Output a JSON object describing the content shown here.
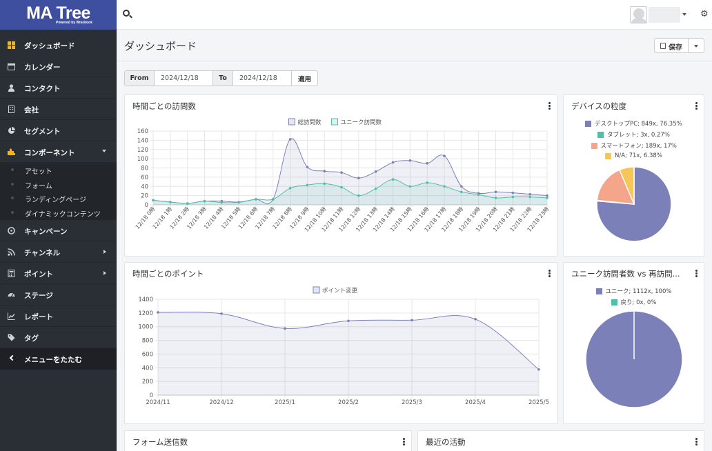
{
  "app": {
    "logo": "MA Tree",
    "logo_sub": "Powered by Wisebook"
  },
  "sidebar": {
    "items": [
      {
        "label": "ダッシュボード",
        "icon": "dashboard-icon"
      },
      {
        "label": "カレンダー",
        "icon": "calendar-icon"
      },
      {
        "label": "コンタクト",
        "icon": "user-icon"
      },
      {
        "label": "会社",
        "icon": "building-icon"
      },
      {
        "label": "セグメント",
        "icon": "pie-chart-icon"
      },
      {
        "label": "コンポーネント",
        "icon": "puzzle-icon"
      },
      {
        "label": "キャンペーン",
        "icon": "clock-icon"
      },
      {
        "label": "チャンネル",
        "icon": "rss-icon"
      },
      {
        "label": "ポイント",
        "icon": "calculator-icon"
      },
      {
        "label": "ステージ",
        "icon": "tachometer-icon"
      },
      {
        "label": "レポート",
        "icon": "line-chart-icon"
      },
      {
        "label": "タグ",
        "icon": "tag-icon"
      }
    ],
    "sub_items": [
      "アセット",
      "フォーム",
      "ランディングページ",
      "ダイナミックコンテンツ"
    ],
    "collapse_label": "メニューをたたむ"
  },
  "colors": {
    "sidebar_bg": "#2a2f36",
    "logo_bg": "#3f4f9f",
    "purple": "#7c80b8",
    "teal": "#4fbfa8",
    "salmon": "#f4a58a",
    "yellow": "#f7c659",
    "accent_orange": "#f4b31e"
  },
  "page": {
    "title": "ダッシュボード",
    "save_label": "保存"
  },
  "filter": {
    "from_label": "From",
    "from_value": "2024/12/18",
    "to_label": "To",
    "to_value": "2024/12/18",
    "apply_label": "適用"
  },
  "panels": {
    "visits_title": "時間ごとの訪問数",
    "device_title": "デバイスの粒度",
    "points_title": "時間ごとのポイント",
    "unique_title": "ユニーク訪問者数 vs 再訪問...",
    "forms_title": "フォーム送信数",
    "activity_title": "最近の活動"
  },
  "chart_data": [
    {
      "type": "area",
      "id": "visits",
      "x": [
        "12/18 0時",
        "12/18 1時",
        "12/18 2時",
        "12/18 3時",
        "12/18 4時",
        "12/18 5時",
        "12/18 6時",
        "12/18 7時",
        "12/18 8時",
        "12/18 9時",
        "12/18 10時",
        "12/18 11時",
        "12/18 12時",
        "12/18 13時",
        "12/18 14時",
        "12/18 15時",
        "12/18 16時",
        "12/18 17時",
        "12/18 18時",
        "12/18 19時",
        "12/18 20時",
        "12/18 21時",
        "12/18 22時",
        "12/18 23時"
      ],
      "series": [
        {
          "name": "総訪問数",
          "color": "#7c80b8",
          "values": [
            10,
            6,
            3,
            8,
            8,
            6,
            12,
            12,
            142,
            82,
            73,
            70,
            58,
            72,
            92,
            96,
            90,
            106,
            40,
            25,
            28,
            26,
            23,
            20
          ]
        },
        {
          "name": "ユニーク訪問数",
          "color": "#4fbfa8",
          "values": [
            10,
            6,
            3,
            8,
            5,
            5,
            12,
            12,
            36,
            43,
            46,
            38,
            20,
            35,
            55,
            40,
            48,
            40,
            28,
            22,
            15,
            17,
            17,
            15
          ]
        }
      ],
      "ylim": [
        0,
        160
      ],
      "yticks": [
        0,
        20,
        40,
        60,
        80,
        100,
        120,
        140,
        160
      ],
      "grid": true,
      "legend": "top"
    },
    {
      "type": "pie",
      "id": "devices",
      "labels": [
        "デスクトップPC; 849x, 76.35%",
        "タブレット; 3x, 0.27%",
        "スマートフォン; 189x, 17%",
        "N/A; 71x, 6.38%"
      ],
      "values": [
        76.35,
        0.27,
        17,
        6.38
      ],
      "colors": [
        "#7c80b8",
        "#4fbfa8",
        "#f4a58a",
        "#f7c659"
      ],
      "legend": "top"
    },
    {
      "type": "area",
      "id": "points",
      "x": [
        "2024/11",
        "2024/12",
        "2025/1",
        "2025/2",
        "2025/3",
        "2025/4",
        "2025/5"
      ],
      "series": [
        {
          "name": "ポイント変更",
          "color": "#7c80b8",
          "values": [
            1210,
            1190,
            975,
            1085,
            1095,
            1110,
            375
          ]
        }
      ],
      "ylim": [
        0,
        1400
      ],
      "yticks": [
        0,
        200,
        400,
        600,
        800,
        1000,
        1200,
        1400
      ],
      "grid": true,
      "legend": "top"
    },
    {
      "type": "pie",
      "id": "unique",
      "labels": [
        "ユニーク; 1112x, 100%",
        "戻り; 0x, 0%"
      ],
      "values": [
        100,
        0
      ],
      "colors": [
        "#7c80b8",
        "#4fbfa8"
      ],
      "legend": "top"
    }
  ]
}
